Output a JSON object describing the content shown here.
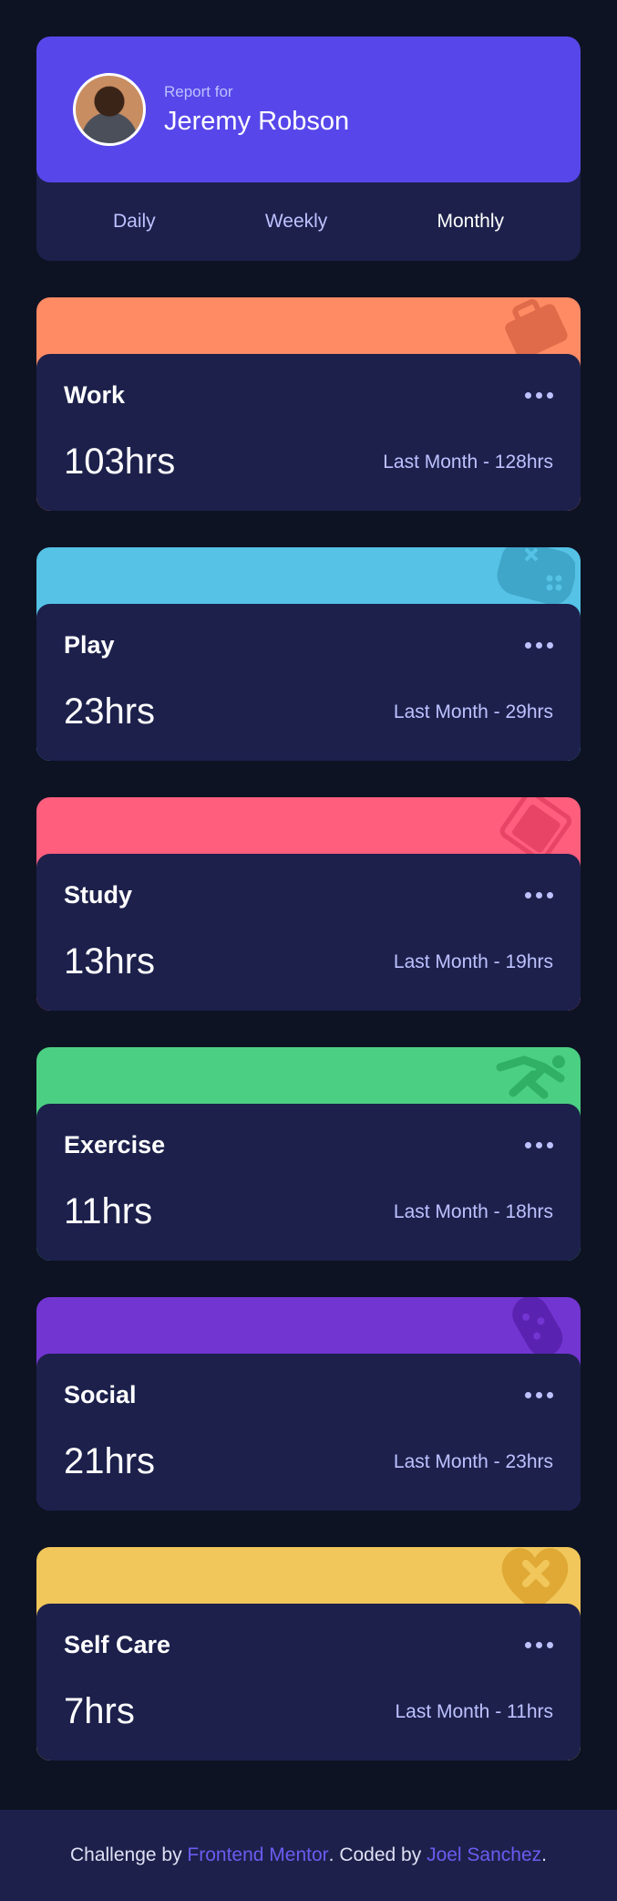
{
  "profile": {
    "report_for": "Report for",
    "name": "Jeremy Robson",
    "avatar_alt": "Jeremy Robson avatar",
    "periods": [
      {
        "label": "Daily",
        "active": false
      },
      {
        "label": "Weekly",
        "active": false
      },
      {
        "label": "Monthly",
        "active": true
      }
    ]
  },
  "activities": [
    {
      "title": "Work",
      "hours": "103hrs",
      "previous": "Last Month - 128hrs",
      "color": "#ff8b64",
      "icon_color": "#e06b4a",
      "icon": "briefcase-icon"
    },
    {
      "title": "Play",
      "hours": "23hrs",
      "previous": "Last Month - 29hrs",
      "color": "#55c2e6",
      "icon_color": "#3fa6c9",
      "icon": "gamepad-icon"
    },
    {
      "title": "Study",
      "hours": "13hrs",
      "previous": "Last Month - 19hrs",
      "color": "#ff5e7d",
      "icon_color": "#e84466",
      "icon": "book-icon"
    },
    {
      "title": "Exercise",
      "hours": "11hrs",
      "previous": "Last Month - 18hrs",
      "color": "#4bcf82",
      "icon_color": "#2fb065",
      "icon": "running-icon"
    },
    {
      "title": "Social",
      "hours": "21hrs",
      "previous": "Last Month - 23hrs",
      "color": "#7335d2",
      "icon_color": "#5a22b0",
      "icon": "balloon-icon"
    },
    {
      "title": "Self Care",
      "hours": "7hrs",
      "previous": "Last Month - 11hrs",
      "color": "#f1c75b",
      "icon_color": "#e0a935",
      "icon": "heart-bandage-icon"
    }
  ],
  "footer": {
    "challenge_by": "Challenge by ",
    "frontend_mentor": "Frontend Mentor",
    "coded_by": ". Coded by ",
    "author": "Joel Sanchez",
    "end": "."
  }
}
